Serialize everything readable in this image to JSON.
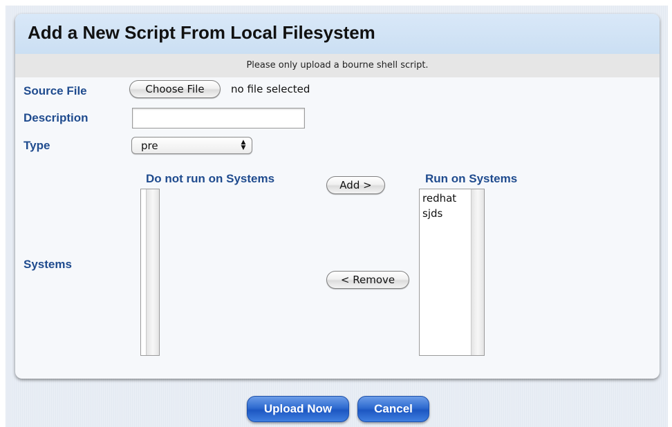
{
  "dialog": {
    "title": "Add a New Script From Local Filesystem",
    "notice": "Please only upload a bourne shell script."
  },
  "fields": {
    "source_file": {
      "label": "Source File",
      "button_label": "Choose File",
      "status_text": "no file selected"
    },
    "description": {
      "label": "Description",
      "value": ""
    },
    "type": {
      "label": "Type",
      "selected": "pre"
    },
    "systems": {
      "label": "Systems",
      "not_run_heading": "Do not run on Systems",
      "not_run_items": [],
      "run_heading": "Run on Systems",
      "run_items": [
        "redhat",
        "sjds"
      ],
      "add_label": "Add >",
      "remove_label": "< Remove"
    }
  },
  "footer": {
    "upload_label": "Upload Now",
    "cancel_label": "Cancel"
  },
  "colors": {
    "label_blue": "#1f4b8e",
    "header_bg": "#d4e5f6",
    "primary_button": "#2f6bd0"
  },
  "icons": {
    "select_arrows": "updown-chevron-icon"
  }
}
